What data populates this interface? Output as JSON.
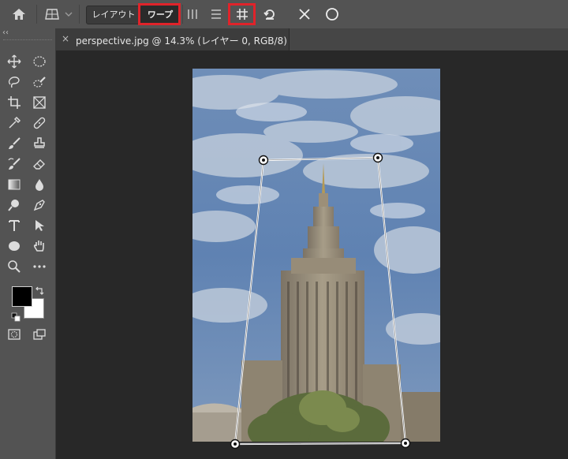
{
  "options_bar": {
    "home_icon": "home-icon",
    "transform_icon": "perspective-warp-icon",
    "layout_label": "レイアウト",
    "warp_label": "ワープ",
    "vertical_lines_icon": "vertical-straighten-icon",
    "horizontal_lines_icon": "horizontal-straighten-icon",
    "grid_icon": "grid-straighten-icon",
    "undo_icon": "reset-icon",
    "cancel_icon": "cancel-icon",
    "commit_icon": "commit-icon",
    "highlight_color": "#e0232a"
  },
  "document": {
    "tab_title": "perspective.jpg @ 14.3% (レイヤー 0, RGB/8)",
    "close_glyph": "×"
  },
  "toolbar": {
    "collapse_glyph": "‹‹",
    "foreground_color": "#000000",
    "background_color": "#ffffff"
  }
}
